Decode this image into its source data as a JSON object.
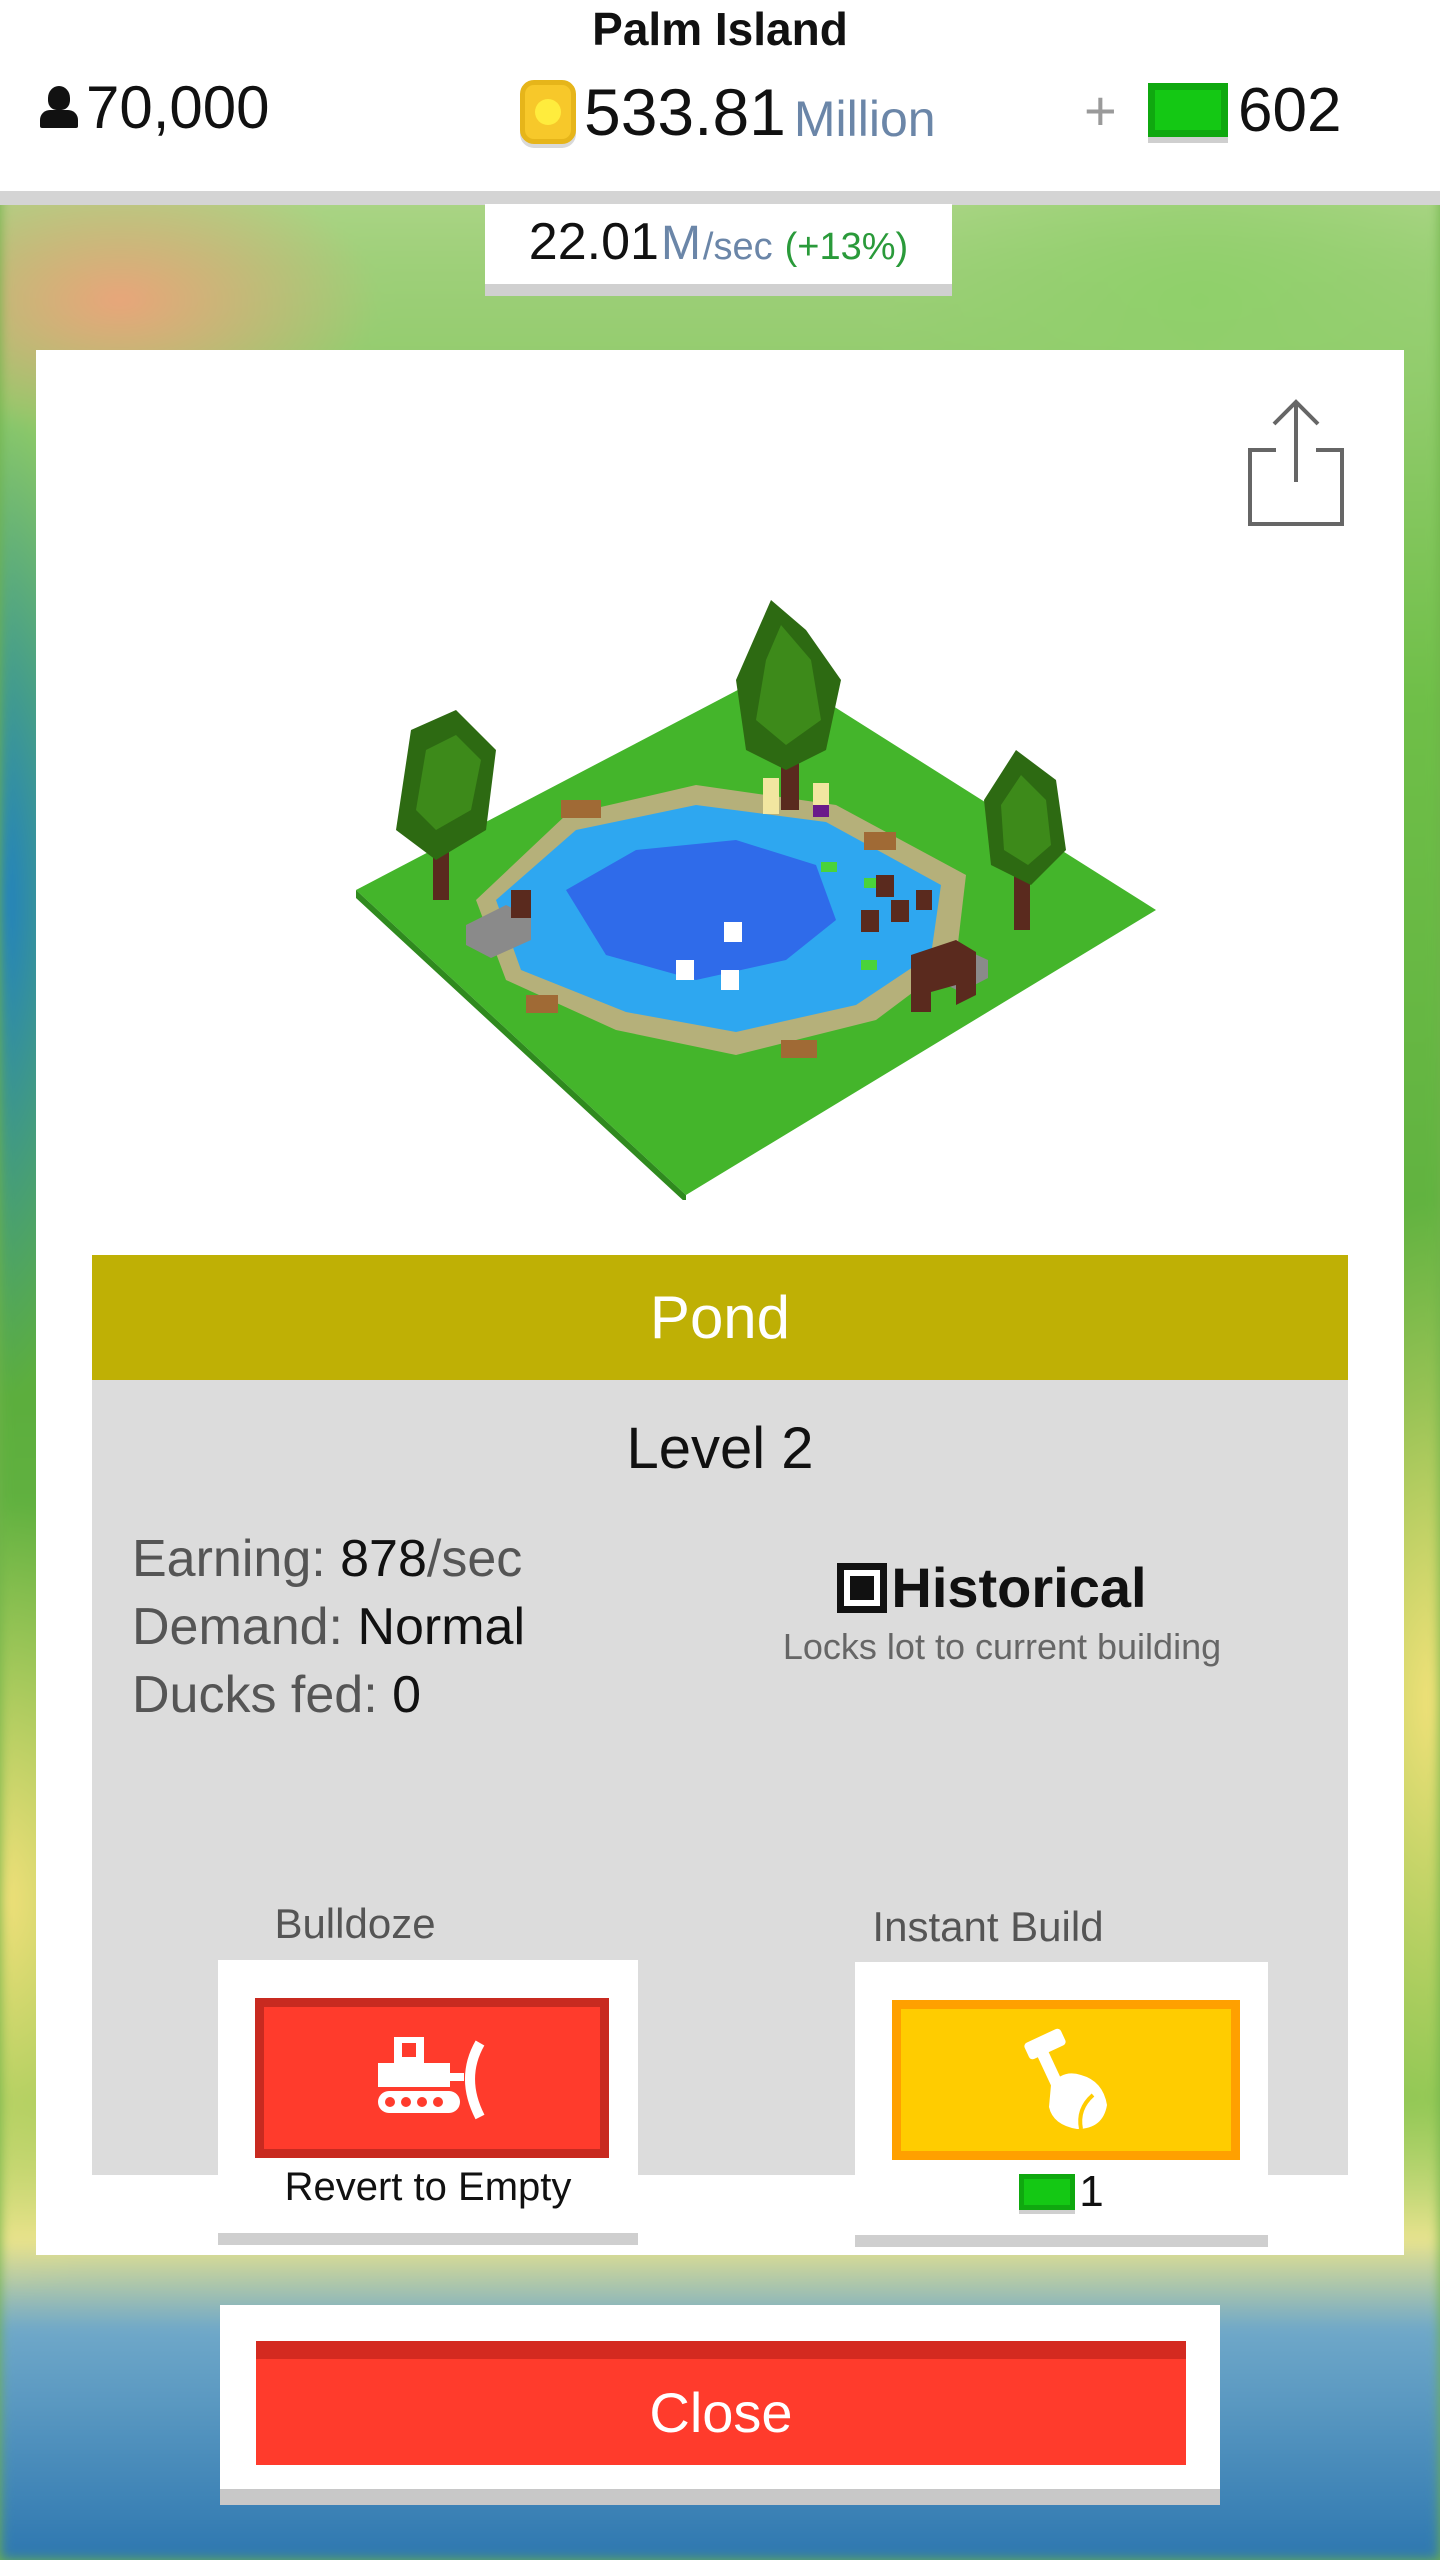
{
  "hud": {
    "island_name": "Palm Island",
    "population": "70,000",
    "money_value": "533.81",
    "money_unit": "Million",
    "plus": "+",
    "gems": "602",
    "rate_value": "22.01",
    "rate_unit": "M",
    "rate_per": "/sec",
    "rate_bonus": "(+13%)",
    "icons": [
      "person-icon",
      "coin-icon",
      "gem-icon"
    ]
  },
  "building": {
    "name": "Pond",
    "level": "Level 2",
    "earning_label": "Earning:",
    "earning_value": "878",
    "earning_unit": "/sec",
    "demand_label": "Demand:",
    "demand_value": "Normal",
    "ducks_label": "Ducks fed:",
    "ducks_value": "0",
    "historical_label": "Historical",
    "historical_checked": true,
    "historical_sub": "Locks lot to current building"
  },
  "actions": {
    "bulldoze_label": "Bulldoze",
    "bulldoze_caption": "Revert to Empty",
    "instant_label": "Instant Build",
    "instant_cost": "1"
  },
  "close_label": "Close",
  "colors": {
    "title_bar": "#bfb005",
    "bulldoze": "#ff3b2c",
    "instant": "#ffcc00",
    "gem": "#14c814",
    "rate_bonus": "#2a9a3a",
    "unit_blue": "#6b86a8"
  }
}
